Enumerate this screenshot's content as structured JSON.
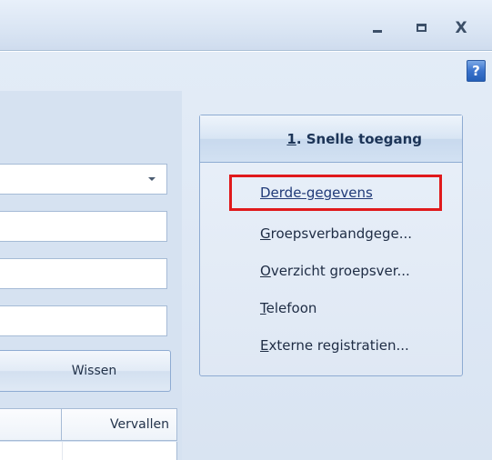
{
  "window": {
    "minimize_glyph": "",
    "close_glyph": "X"
  },
  "help_glyph": "?",
  "form": {
    "wissen_label": "Wissen",
    "grid_column": "Vervallen"
  },
  "quick_access": {
    "header_accel": "1",
    "header_rest": ". Snelle toegang",
    "links": [
      {
        "accel": "",
        "rest": "Derde-gegevens"
      },
      {
        "accel": "G",
        "rest": "roepsverbandgege..."
      },
      {
        "accel": "O",
        "rest": "verzicht groepsver..."
      },
      {
        "accel": "T",
        "rest": "elefoon"
      },
      {
        "accel": "E",
        "rest": "xterne registratien..."
      }
    ]
  },
  "colors": {
    "highlight": "#e0191c",
    "link": "#203a78"
  }
}
